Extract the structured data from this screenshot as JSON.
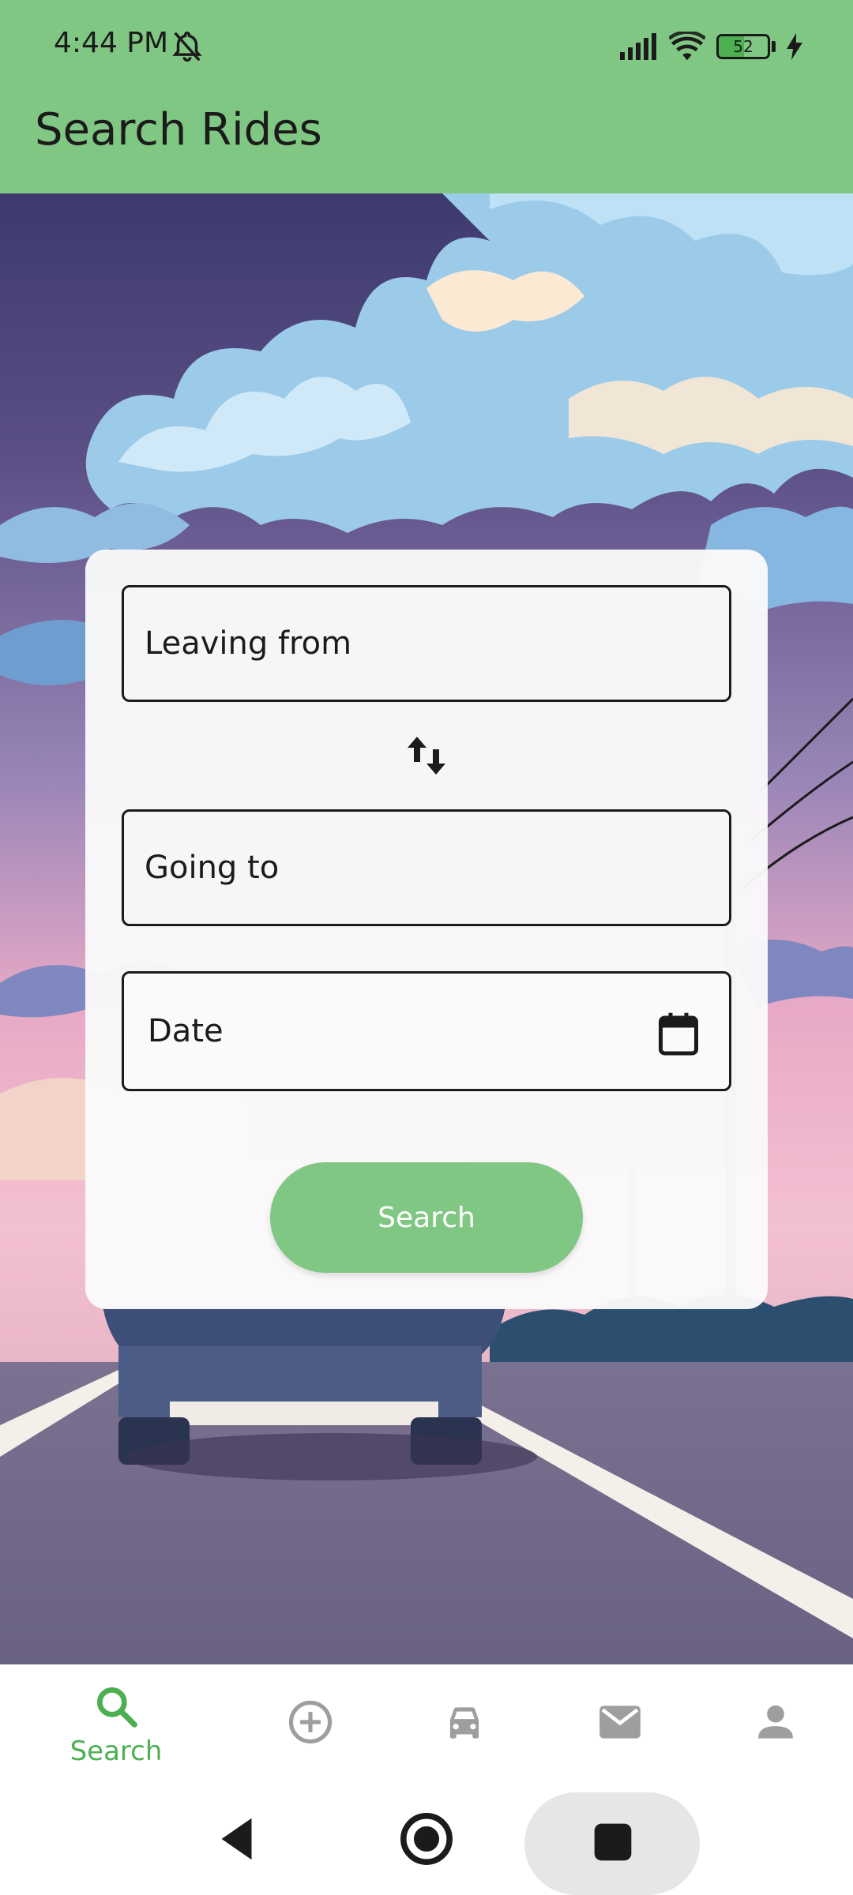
{
  "status_bar": {
    "time": "4:44 PM",
    "battery_level": "52",
    "battery_fraction": 0.52,
    "icons": [
      "mute-notifications-icon",
      "signal-icon",
      "wifi-icon",
      "battery-icon",
      "charging-icon"
    ]
  },
  "app_bar": {
    "title": "Search Rides",
    "color": "#81c784"
  },
  "search_form": {
    "leaving_from_placeholder": "Leaving from",
    "going_to_placeholder": "Going to",
    "date_placeholder": "Date",
    "swap_icon": "swap-vertical-icon",
    "calendar_icon": "calendar-icon",
    "search_label": "Search"
  },
  "bottom_nav": {
    "items": [
      {
        "id": "search",
        "label": "Search",
        "icon": "search-icon",
        "active": true
      },
      {
        "id": "offer",
        "label": "",
        "icon": "add-circle-icon",
        "active": false
      },
      {
        "id": "rides",
        "label": "",
        "icon": "car-icon",
        "active": false
      },
      {
        "id": "messages",
        "label": "",
        "icon": "mail-icon",
        "active": false
      },
      {
        "id": "profile",
        "label": "",
        "icon": "person-icon",
        "active": false
      }
    ],
    "active_color": "#4caf50",
    "inactive_color": "#9e9e9e"
  },
  "system_nav": {
    "buttons": [
      "back-icon",
      "home-icon",
      "recents-icon"
    ]
  }
}
